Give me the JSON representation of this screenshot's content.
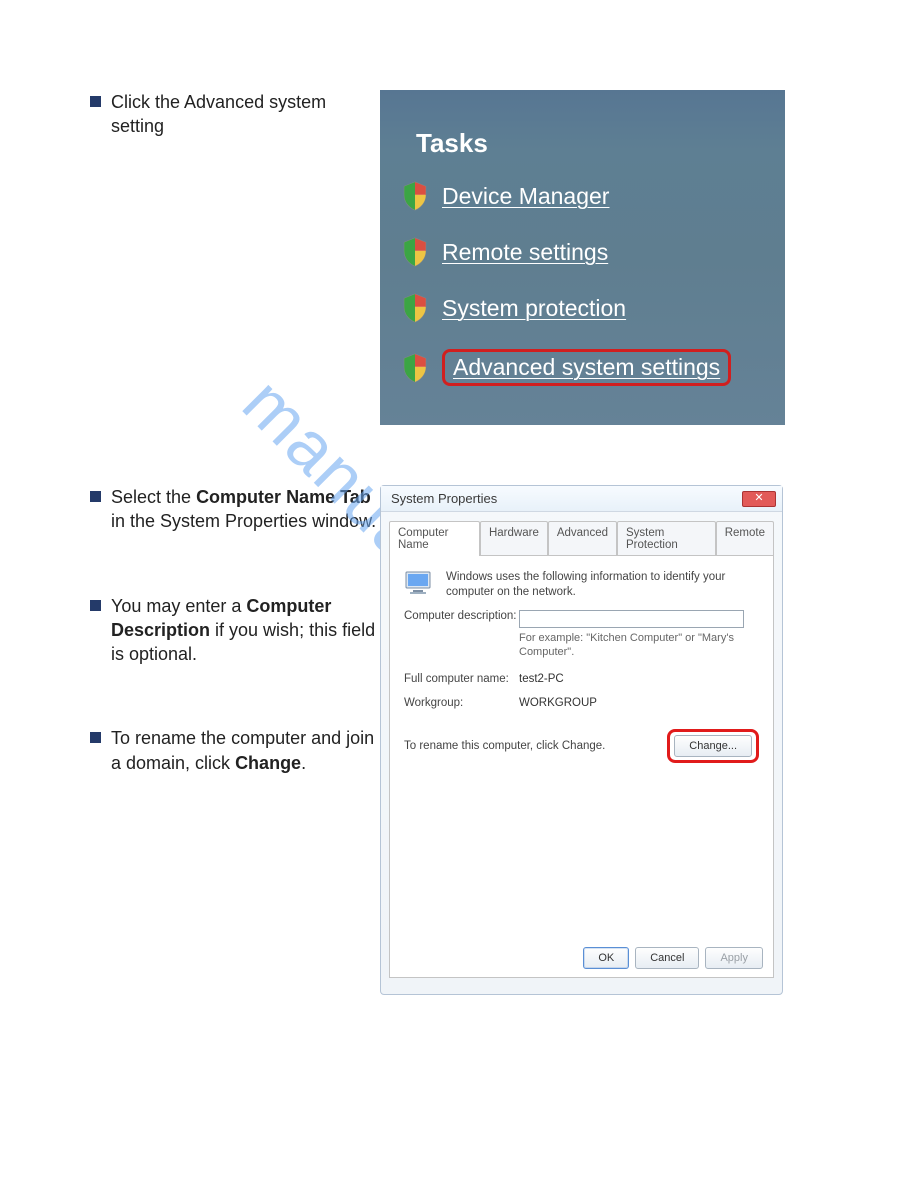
{
  "watermark": "manualshive.com",
  "steps": {
    "s1": "Click the Advanced system setting",
    "s2_pre": "Select the ",
    "s2_bold": "Computer Name Tab",
    "s2_post": " in the System Properties window.",
    "s3_pre": "You may enter a ",
    "s3_bold": "Computer Description",
    "s3_post": " if you wish; this field is optional.",
    "s4_pre": "To rename the computer and join a domain, click ",
    "s4_bold": "Change",
    "s4_post": "."
  },
  "tasks": {
    "title": "Tasks",
    "items": [
      {
        "label": "Device Manager"
      },
      {
        "label": "Remote settings"
      },
      {
        "label": "System protection"
      },
      {
        "label": "Advanced system settings"
      }
    ]
  },
  "dialog": {
    "title": "System Properties",
    "tabs": [
      "Computer Name",
      "Hardware",
      "Advanced",
      "System Protection",
      "Remote"
    ],
    "info_text": "Windows uses the following information to identify your computer on the network.",
    "labels": {
      "desc": "Computer description:",
      "full_name": "Full computer name:",
      "workgroup": "Workgroup:"
    },
    "hint": "For example: \"Kitchen Computer\" or \"Mary's Computer\".",
    "full_computer_name": "test2-PC",
    "workgroup": "WORKGROUP",
    "rename_text": "To rename this computer, click Change.",
    "change_button": "Change...",
    "buttons": {
      "ok": "OK",
      "cancel": "Cancel",
      "apply": "Apply"
    },
    "desc_value": ""
  }
}
